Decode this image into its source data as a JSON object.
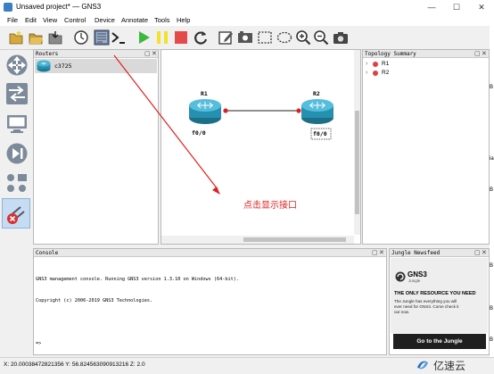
{
  "window": {
    "title": "Unsaved project* — GNS3",
    "minimize_label": "—",
    "maximize_label": "☐",
    "close_label": "✕"
  },
  "menu": [
    "File",
    "Edit",
    "View",
    "Control",
    "Device",
    "Annotate",
    "Tools",
    "Help"
  ],
  "toolbar": {
    "icons": [
      "folder-new-icon",
      "folder-open-icon",
      "save-icon",
      "clock-icon",
      "show-interface-labels-icon",
      "console-icon",
      "start-icon",
      "pause-icon",
      "stop-icon",
      "reload-icon",
      "note-icon",
      "image-icon",
      "rectangle-icon",
      "ellipse-icon",
      "zoom-in-icon",
      "zoom-out-icon",
      "screenshot-icon"
    ],
    "highlight_color": "#e02020"
  },
  "routers_panel": {
    "title": "Routers",
    "items": [
      {
        "label": "c3725"
      }
    ]
  },
  "canvas": {
    "nodes": [
      {
        "name": "R1",
        "interface": "f0/0"
      },
      {
        "name": "R2",
        "interface": "f0/0"
      }
    ],
    "annotation": "点击显示接口",
    "annotation_color": "#e02020"
  },
  "topology_panel": {
    "title": "Topology Summary",
    "items": [
      {
        "label": "R1"
      },
      {
        "label": "R2"
      }
    ]
  },
  "console_panel": {
    "title": "Console",
    "lines": [
      "GNS3 management console. Running GNS3 version 1.3.10 on Windows (64-bit).",
      "Copyright (c) 2006-2019 GNS3 Technologies.",
      "",
      "=>"
    ]
  },
  "jungle_panel": {
    "title": "Jungle Newsfeed",
    "logo_text": "GNS3",
    "logo_sub": "Jungle",
    "headline": "THE ONLY RESOURCE YOU NEED",
    "body": "The Jungle has everything you will ever need for GNS3. Come check it out now.",
    "button": "Go to the Jungle"
  },
  "statusbar": {
    "coords": "X: 20.00038472821356 Y: 56.824563090913216 Z: 2.0",
    "watermark": "亿速云"
  },
  "right_edge_fragments": [
    "B",
    "ial",
    "B",
    "B",
    "B",
    "B"
  ]
}
